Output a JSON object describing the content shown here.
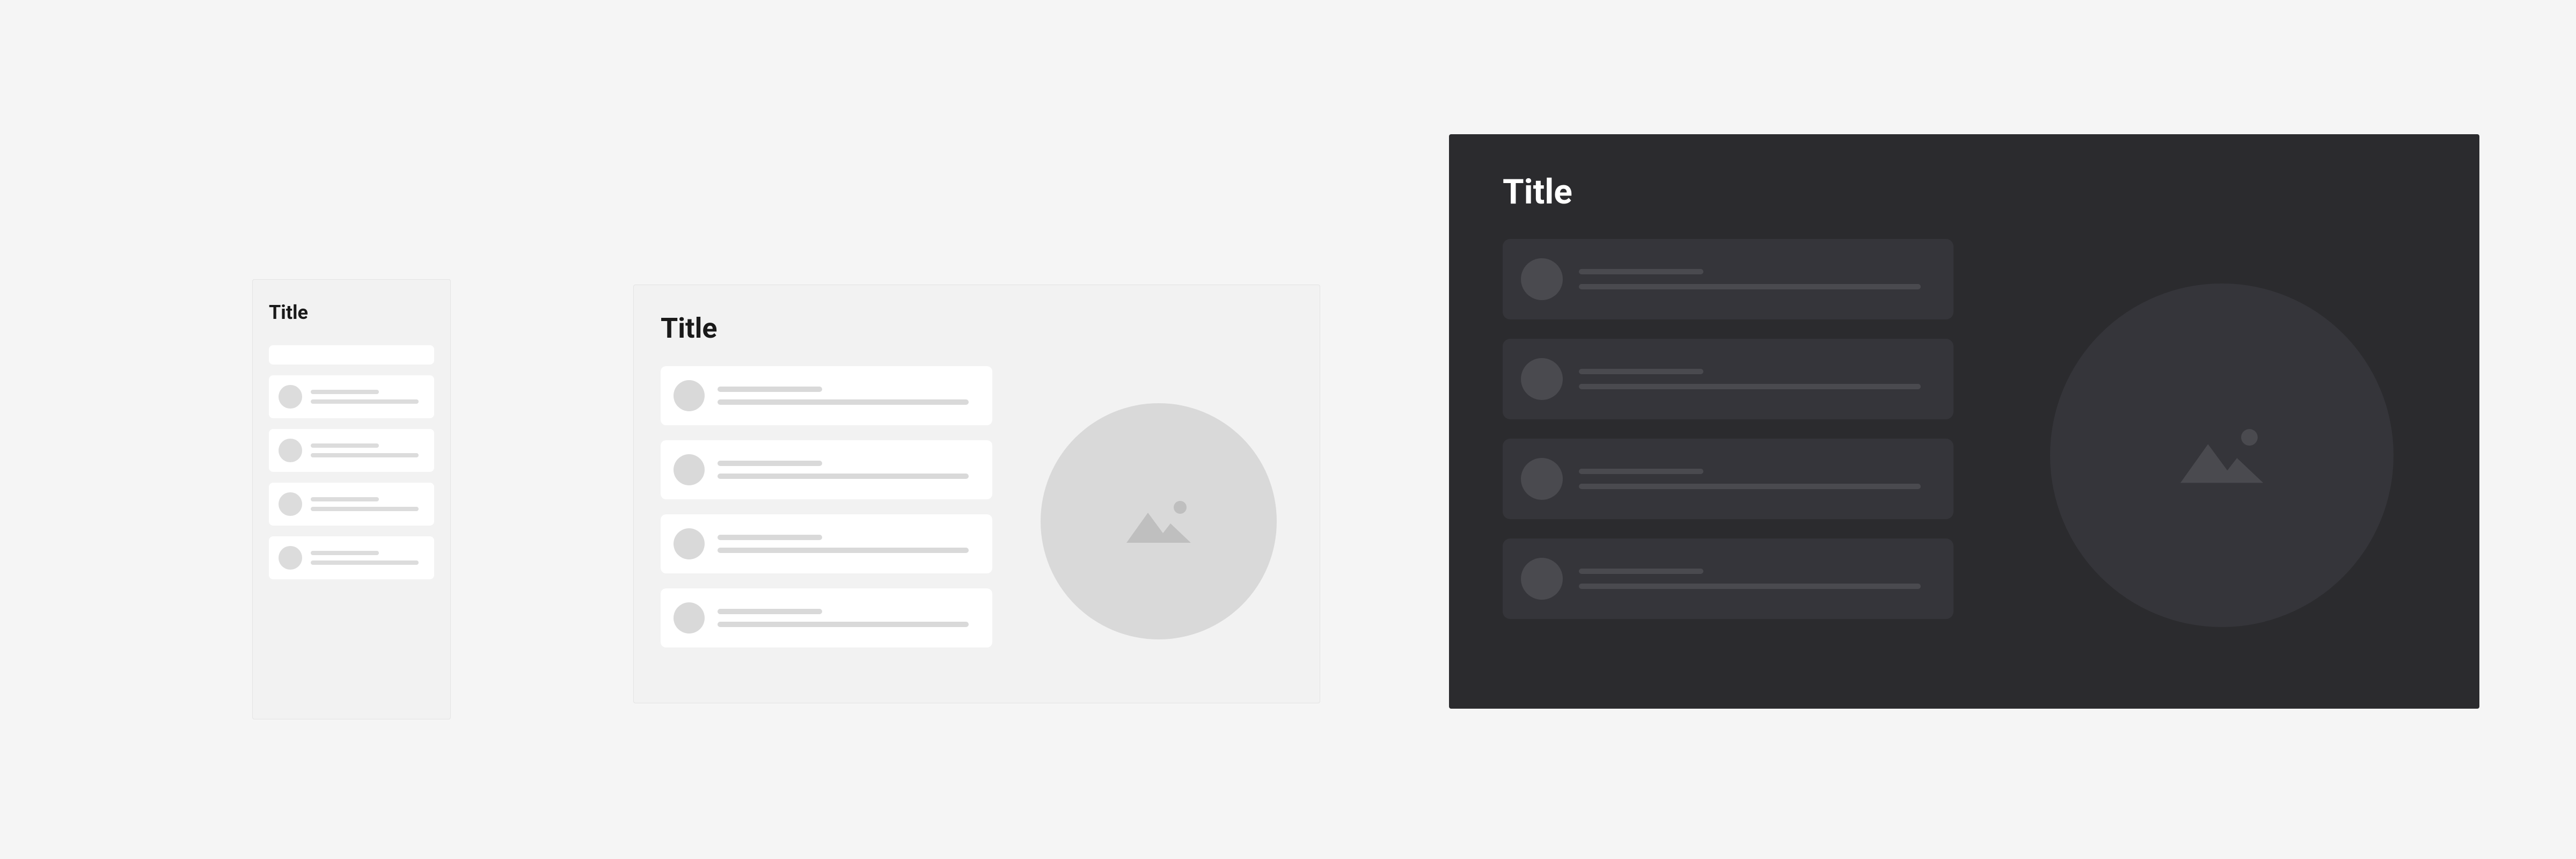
{
  "cards": {
    "small": {
      "title": "Title",
      "items_count": 4
    },
    "medium": {
      "title": "Title",
      "items_count": 4,
      "image_placeholder_icon": "image-icon"
    },
    "large": {
      "title": "Title",
      "items_count": 4,
      "image_placeholder_icon": "image-icon",
      "theme": "dark"
    }
  },
  "colors": {
    "page_bg": "#f5f5f5",
    "light_card_bg": "#f2f2f2",
    "light_item_bg": "#ffffff",
    "light_skeleton": "#d9d9d9",
    "dark_card_bg": "#2b2b2e",
    "dark_item_bg": "#35353a",
    "dark_skeleton": "#4a4a4f",
    "text_dark": "#1a1a1a",
    "text_light": "#ffffff"
  }
}
